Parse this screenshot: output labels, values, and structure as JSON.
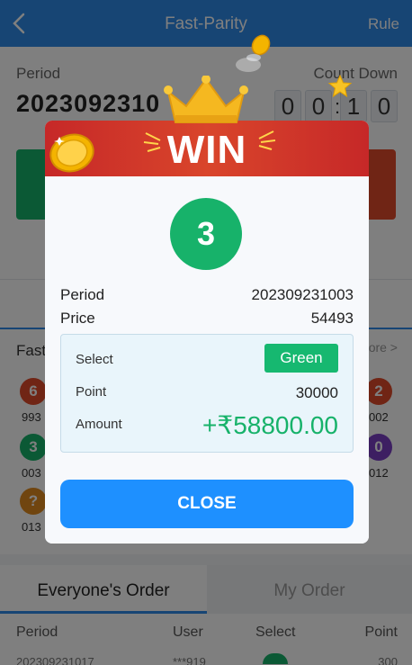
{
  "header": {
    "title": "Fast-Parity",
    "rule_label": "Rule"
  },
  "game": {
    "period_label": "Period",
    "period_value": "2023092310",
    "countdown_label": "Count Down",
    "countdown_digits": [
      "0",
      "0",
      "1",
      "0"
    ],
    "countdown_colon": ":"
  },
  "record": {
    "title": "Fast",
    "more": "ore >",
    "left_balls": [
      {
        "label": "6",
        "num": "993",
        "color": "#e04a2a"
      },
      {
        "label": "3",
        "num": "003",
        "color": "#17b26a"
      },
      {
        "label": "?",
        "num": "013",
        "color": "#e08a1e"
      }
    ],
    "right_balls": [
      {
        "label": "2",
        "num": "002",
        "color": "#e04a2a"
      },
      {
        "label": "0",
        "num": "012",
        "color": "#7a3fc4"
      }
    ]
  },
  "orders": {
    "tab_everyone": "Everyone's Order",
    "tab_mine": "My Order",
    "col_period": "Period",
    "col_user": "User",
    "col_select": "Select",
    "col_point": "Point",
    "row_period_fragment": "202309231017",
    "row_user_fragment": "***919",
    "row_point_fragment": "300"
  },
  "modal": {
    "win_title": "WIN",
    "result_number": "3",
    "period_label": "Period",
    "period_value": "202309231003",
    "price_label": "Price",
    "price_value": "54493",
    "select_label": "Select",
    "select_value": "Green",
    "point_label": "Point",
    "point_value": "30000",
    "amount_label": "Amount",
    "amount_value": "+₹58800.00",
    "close_label": "CLOSE"
  },
  "colors": {
    "brand_blue": "#2f8ae8",
    "win_red": "#c62828",
    "green": "#17b26a",
    "close_blue": "#1e90ff"
  }
}
